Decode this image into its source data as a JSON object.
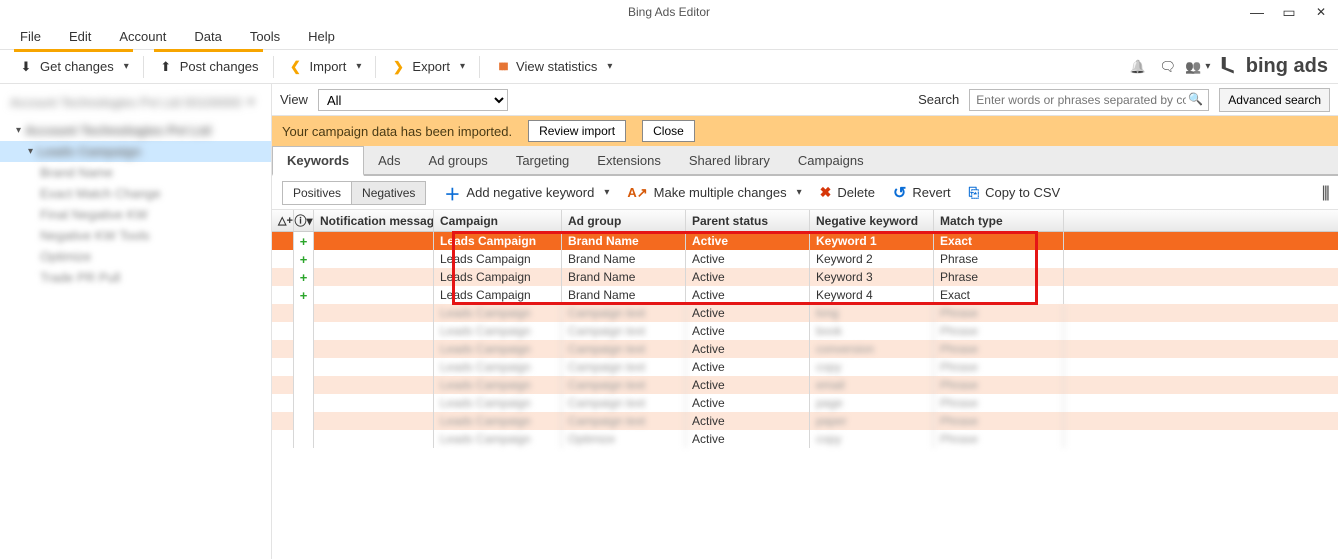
{
  "app": {
    "title": "Bing Ads Editor"
  },
  "menu": {
    "file": "File",
    "edit": "Edit",
    "account": "Account",
    "data": "Data",
    "tools": "Tools",
    "help": "Help"
  },
  "toolbar": {
    "get_changes": "Get changes",
    "post_changes": "Post changes",
    "import": "Import",
    "export": "Export",
    "view_stats": "View statistics",
    "brand": "bing ads"
  },
  "sidebar": {
    "account": "Account Technologies Pvt Ltd   00100000",
    "root": "Account Technologies Pvt Ltd",
    "campaign": "Leads Campaign",
    "items": [
      "Brand Name",
      "Exact Match Change",
      "Final Negative KW",
      "Negative KW Tools",
      "Optimize",
      "Trade PR Pull"
    ]
  },
  "view": {
    "label": "View",
    "selected": "All"
  },
  "search": {
    "label": "Search",
    "placeholder": "Enter words or phrases separated by co",
    "advanced": "Advanced search"
  },
  "notice": {
    "msg": "Your campaign data has been imported.",
    "review": "Review import",
    "close": "Close"
  },
  "tabs": {
    "keywords": "Keywords",
    "ads": "Ads",
    "adgroups": "Ad groups",
    "targeting": "Targeting",
    "extensions": "Extensions",
    "shared": "Shared library",
    "campaigns": "Campaigns"
  },
  "subtb": {
    "positives": "Positives",
    "negatives": "Negatives",
    "add": "Add negative keyword",
    "multi": "Make multiple changes",
    "delete": "Delete",
    "revert": "Revert",
    "csv": "Copy to CSV"
  },
  "columns": {
    "delta": "△+",
    "info": "⓵",
    "notif": "Notification message",
    "campaign": "Campaign",
    "adgroup": "Ad group",
    "parent": "Parent status",
    "neg": "Negative keyword",
    "match": "Match type"
  },
  "rows": [
    {
      "sel": true,
      "campaign": "Leads Campaign",
      "adgroup": "Brand Name",
      "parent": "Active",
      "neg": "Keyword 1",
      "match": "Exact"
    },
    {
      "campaign": "Leads Campaign",
      "adgroup": "Brand Name",
      "parent": "Active",
      "neg": "Keyword 2",
      "match": "Phrase"
    },
    {
      "campaign": "Leads Campaign",
      "adgroup": "Brand Name",
      "parent": "Active",
      "neg": "Keyword 3",
      "match": "Phrase"
    },
    {
      "campaign": "Leads Campaign",
      "adgroup": "Brand Name",
      "parent": "Active",
      "neg": "Keyword 4",
      "match": "Exact"
    },
    {
      "blur": true,
      "campaign": "Leads Campaign",
      "adgroup": "Campaign text",
      "parent": "Active",
      "neg": "long",
      "match": "Phrase"
    },
    {
      "blur": true,
      "campaign": "Leads Campaign",
      "adgroup": "Campaign text",
      "parent": "Active",
      "neg": "book",
      "match": "Phrase"
    },
    {
      "blur": true,
      "campaign": "Leads Campaign",
      "adgroup": "Campaign text",
      "parent": "Active",
      "neg": "conversion",
      "match": "Phrase"
    },
    {
      "blur": true,
      "campaign": "Leads Campaign",
      "adgroup": "Campaign text",
      "parent": "Active",
      "neg": "copy",
      "match": "Phrase"
    },
    {
      "blur": true,
      "campaign": "Leads Campaign",
      "adgroup": "Campaign text",
      "parent": "Active",
      "neg": "email",
      "match": "Phrase"
    },
    {
      "blur": true,
      "campaign": "Leads Campaign",
      "adgroup": "Campaign text",
      "parent": "Active",
      "neg": "page",
      "match": "Phrase"
    },
    {
      "blur": true,
      "campaign": "Leads Campaign",
      "adgroup": "Campaign text",
      "parent": "Active",
      "neg": "paper",
      "match": "Phrase"
    },
    {
      "blur": true,
      "campaign": "Leads Campaign",
      "adgroup": "Optimize",
      "parent": "Active",
      "neg": "copy",
      "match": "Phrase"
    }
  ]
}
